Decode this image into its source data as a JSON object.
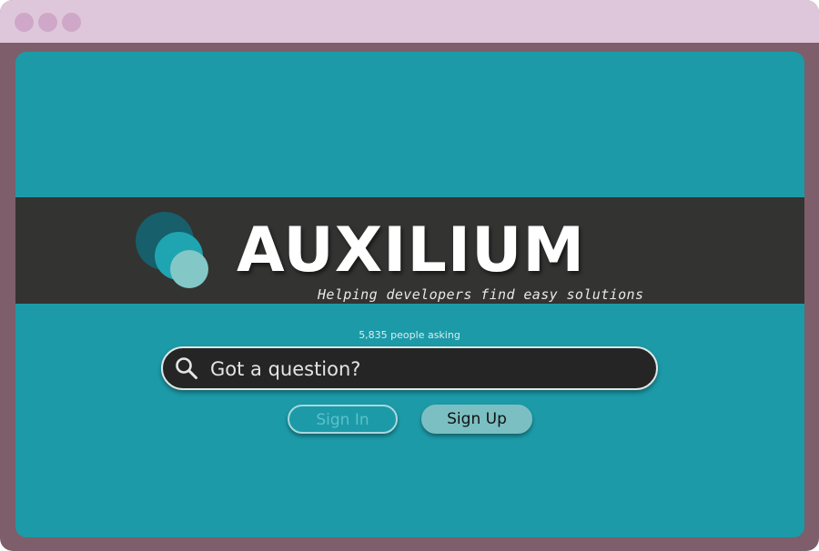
{
  "app": {
    "brand": "AUXILIUM",
    "tagline": "Helping developers find easy solutions"
  },
  "stats": {
    "people_asking": "5,835 people asking"
  },
  "search": {
    "placeholder": "Got a question?",
    "value": ""
  },
  "auth": {
    "sign_in_label": "Sign In",
    "sign_up_label": "Sign Up"
  },
  "icons": {
    "search": "search-icon",
    "logo": "circles-logo-icon"
  },
  "colors": {
    "window_frame": "#7d5e6a",
    "titlebar": "#dfc7db",
    "page_background": "#1c9aa8",
    "banner": "#333332",
    "search_background": "#252525",
    "sign_up_button": "#7bbfc2"
  }
}
